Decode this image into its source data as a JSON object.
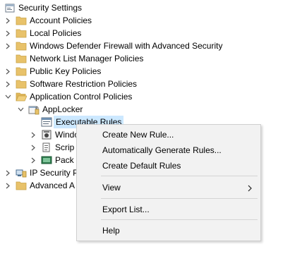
{
  "tree": {
    "root_label": "Security Settings",
    "items": [
      {
        "label": "Account Policies"
      },
      {
        "label": "Local Policies"
      },
      {
        "label": "Windows Defender Firewall with Advanced Security"
      },
      {
        "label": "Network List Manager Policies"
      },
      {
        "label": "Public Key Policies"
      },
      {
        "label": "Software Restriction Policies"
      },
      {
        "label": "Application Control Policies"
      },
      {
        "label": "AppLocker"
      },
      {
        "label": "Executable Rules"
      },
      {
        "label": "Windo"
      },
      {
        "label": "Scrip"
      },
      {
        "label": "Pack"
      },
      {
        "label": "IP Security P"
      },
      {
        "label": "Advanced A"
      }
    ]
  },
  "context_menu": {
    "items": [
      {
        "label": "Create New Rule..."
      },
      {
        "label": "Automatically Generate Rules..."
      },
      {
        "label": "Create Default Rules"
      },
      {
        "label": "View"
      },
      {
        "label": "Export List..."
      },
      {
        "label": "Help"
      }
    ]
  },
  "colors": {
    "selection": "#cce8ff",
    "folder": "#e8c26a",
    "menu_bg": "#f2f2f2"
  },
  "icons": {
    "root": "security-settings-icon",
    "folder": "folder-icon",
    "applocker": "applocker-icon",
    "rules": "rules-icon",
    "script": "script-icon",
    "package": "package-icon",
    "ipsec": "ip-security-icon"
  }
}
